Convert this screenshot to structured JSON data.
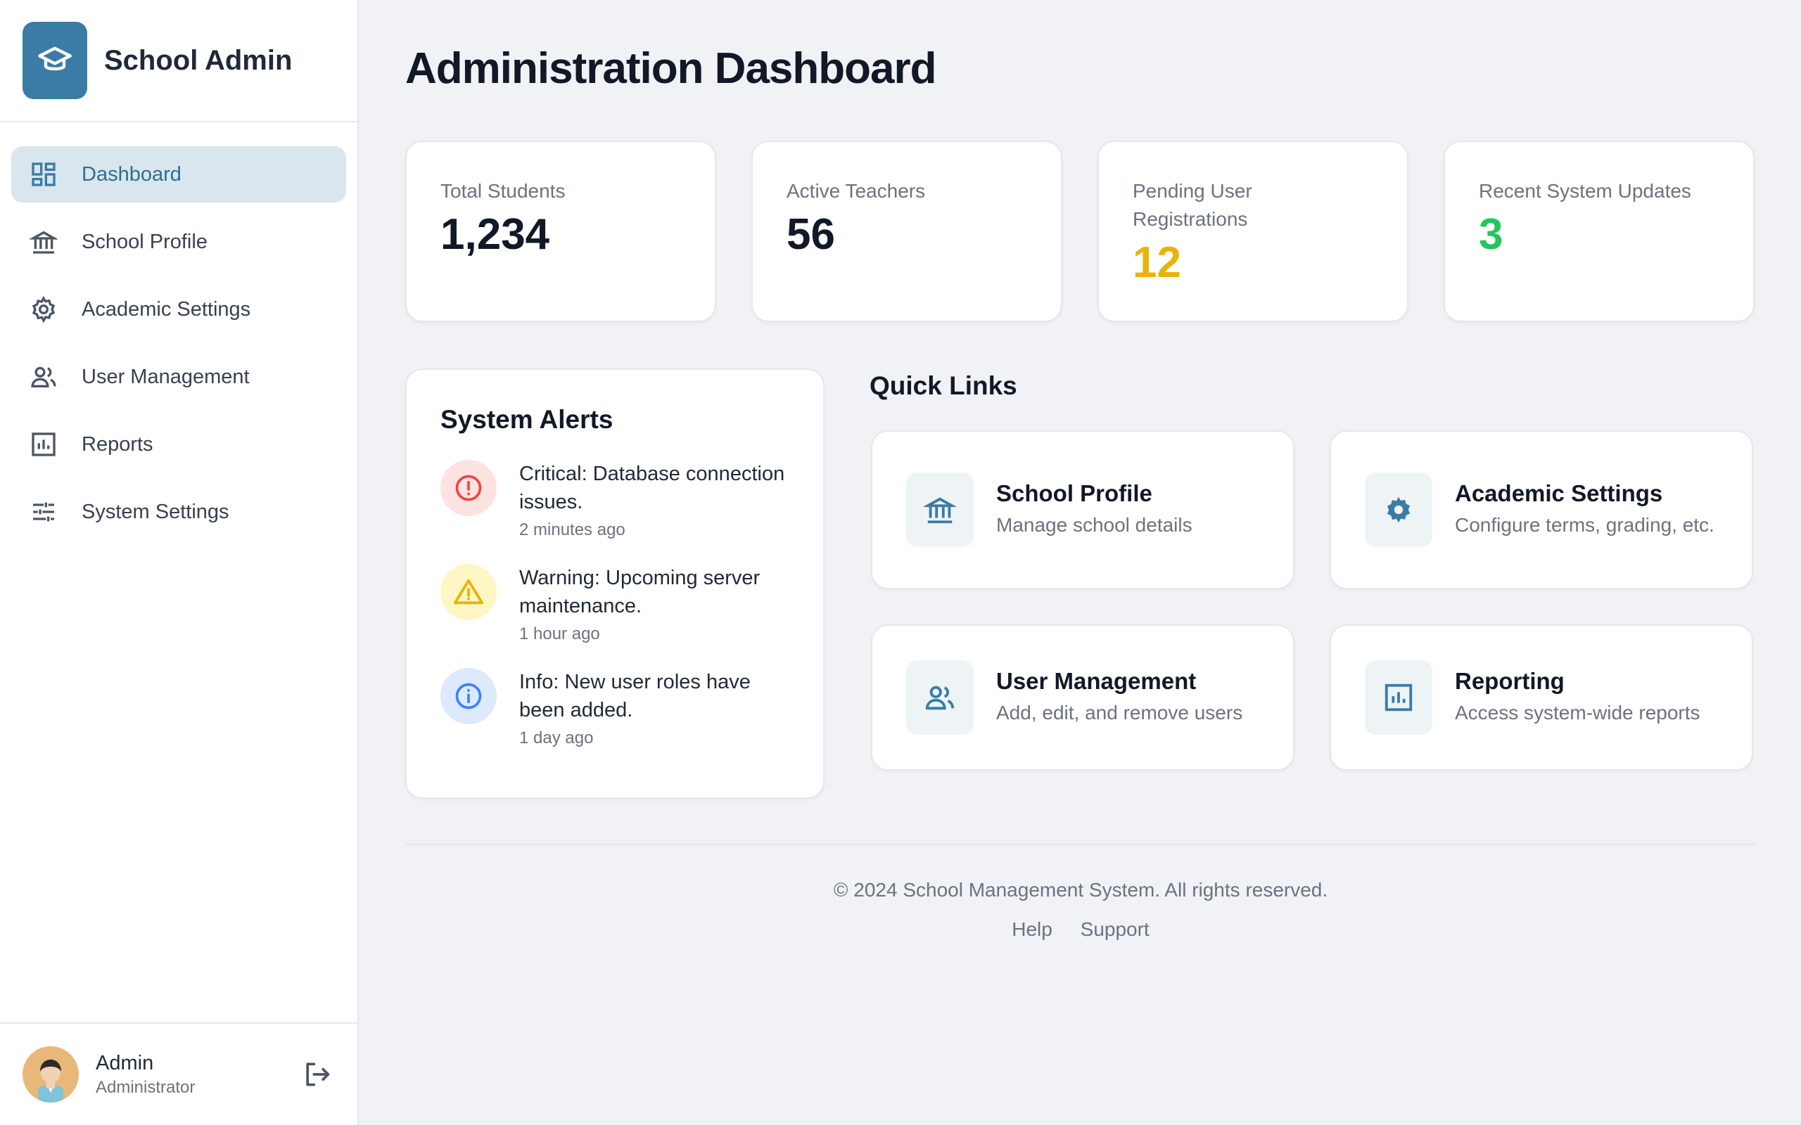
{
  "sidebar": {
    "brand": {
      "title": "School Admin",
      "icon": "graduation-cap-icon"
    },
    "items": [
      {
        "label": "Dashboard",
        "icon": "dashboard-icon",
        "active": true
      },
      {
        "label": "School Profile",
        "icon": "institution-icon"
      },
      {
        "label": "Academic Settings",
        "icon": "gear-icon"
      },
      {
        "label": "User Management",
        "icon": "users-icon"
      },
      {
        "label": "Reports",
        "icon": "bar-chart-icon"
      },
      {
        "label": "System Settings",
        "icon": "sliders-icon"
      }
    ],
    "user": {
      "name": "Admin",
      "role": "Administrator",
      "logout_icon": "logout-icon"
    }
  },
  "main": {
    "title": "Administration Dashboard",
    "stats": [
      {
        "label": "Total Students",
        "value": "1,234",
        "color": "#111827"
      },
      {
        "label": "Active Teachers",
        "value": "56",
        "color": "#111827"
      },
      {
        "label": "Pending User Registrations",
        "value": "12",
        "color": "#eab308"
      },
      {
        "label": "Recent System Updates",
        "value": "3",
        "color": "#22c55e"
      }
    ],
    "alerts": {
      "title": "System Alerts",
      "items": [
        {
          "text": "Critical: Database connection issues.",
          "time": "2 minutes ago",
          "icon": "exclamation-circle-icon",
          "color": "#ef4444",
          "bg": "#fde2e2"
        },
        {
          "text": "Warning: Upcoming server maintenance.",
          "time": "1 hour ago",
          "icon": "warning-triangle-icon",
          "color": "#eab308",
          "bg": "#fef6c3"
        },
        {
          "text": "Info: New user roles have been added.",
          "time": "1 day ago",
          "icon": "info-circle-icon",
          "color": "#3b82f6",
          "bg": "#dde9fc"
        }
      ]
    },
    "quick_links": {
      "title": "Quick Links",
      "items": [
        {
          "name": "School Profile",
          "desc": "Manage school details",
          "icon": "institution-icon"
        },
        {
          "name": "Academic Settings",
          "desc": "Configure terms, grading, etc.",
          "icon": "gear-icon"
        },
        {
          "name": "User Management",
          "desc": "Add, edit, and remove users",
          "icon": "users-icon"
        },
        {
          "name": "Reporting",
          "desc": "Access system-wide reports",
          "icon": "bar-chart-icon"
        }
      ]
    }
  },
  "footer": {
    "copyright": "© 2024 School Management System. All rights reserved.",
    "links": [
      "Help",
      "Support"
    ]
  },
  "colors": {
    "accent": "#3a7ca5",
    "active_bg": "#dae6ee"
  }
}
